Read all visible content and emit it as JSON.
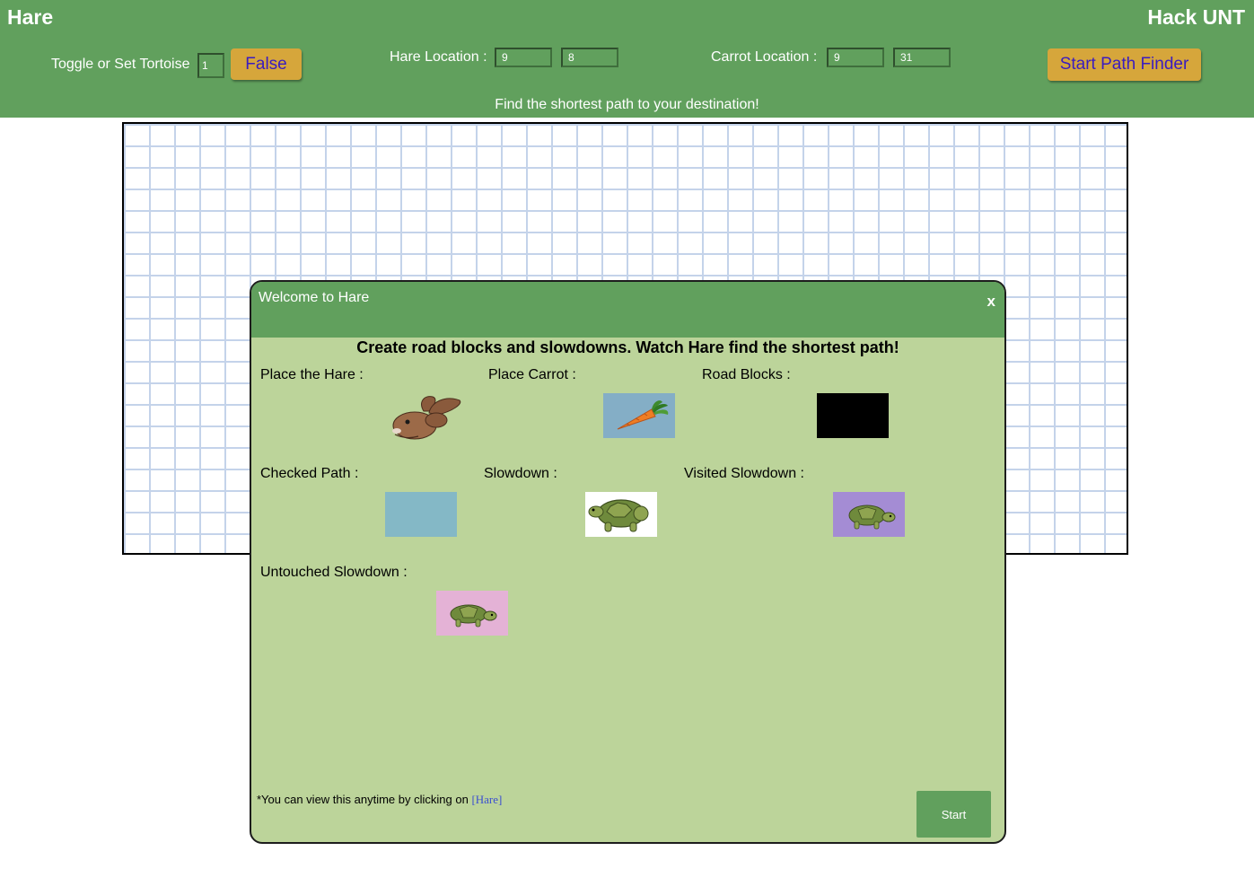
{
  "header": {
    "brand_left": "Hare",
    "brand_right": "Hack UNT",
    "toggle_label": "Toggle or Set Tortoise",
    "toggle_value": "1",
    "toggle_button": "False",
    "hare_label": "Hare Location :",
    "hare_row": "9",
    "hare_col": "8",
    "carrot_label": "Carrot Location :",
    "carrot_row": "9",
    "carrot_col": "31",
    "start_path_button": "Start Path Finder",
    "tagline": "Find the shortest path to your destination!"
  },
  "modal": {
    "title": "Welcome to Hare",
    "close": "x",
    "heading": "Create road blocks and slowdowns. Watch Hare find the shortest path!",
    "legend": {
      "hare": "Place the Hare :",
      "carrot": "Place Carrot :",
      "road_blocks": "Road Blocks :",
      "checked_path": "Checked Path :",
      "slowdown": "Slowdown :",
      "visited_slowdown": "Visited Slowdown :",
      "untouched_slowdown": "Untouched Slowdown :"
    },
    "footnote_text": "*You can view this anytime by clicking on",
    "footnote_link": "[Hare]",
    "start_button": "Start"
  },
  "colors": {
    "header_green": "#61a05d",
    "modal_bg": "#bcd49a",
    "button_gold": "#d6a63b",
    "checked_path": "#84b8c6",
    "visited_slowdown": "#a48cd4",
    "untouched_slowdown": "#e4b2d6",
    "road_block": "#000000"
  },
  "icons": [
    "hare-icon",
    "carrot-icon",
    "tortoise-icon"
  ]
}
